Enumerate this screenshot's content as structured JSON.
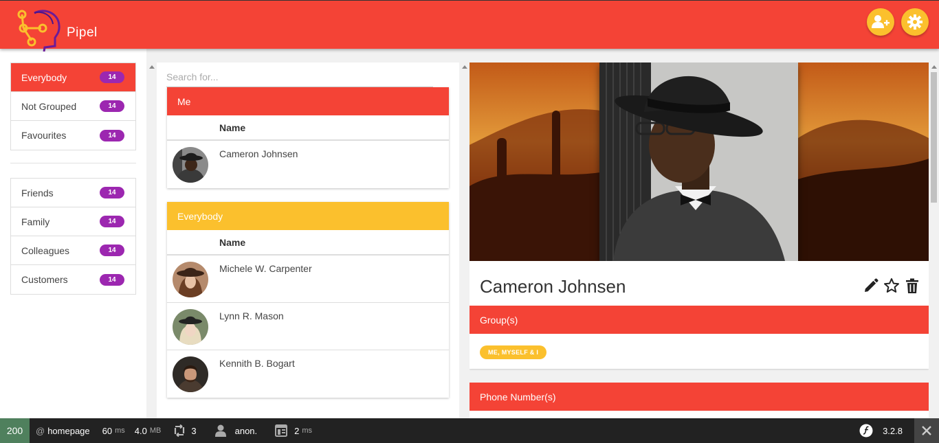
{
  "app": {
    "brand": "Pipel"
  },
  "header": {
    "add_contact_icon": "add-user-icon",
    "settings_icon": "gear-icon"
  },
  "sidebar": {
    "groups_top": [
      {
        "label": "Everybody",
        "count": "14",
        "active": true
      },
      {
        "label": "Not Grouped",
        "count": "14",
        "active": false
      },
      {
        "label": "Favourites",
        "count": "14",
        "active": false
      }
    ],
    "groups_custom": [
      {
        "label": "Friends",
        "count": "14"
      },
      {
        "label": "Family",
        "count": "14"
      },
      {
        "label": "Colleagues",
        "count": "14"
      },
      {
        "label": "Customers",
        "count": "14"
      }
    ]
  },
  "list": {
    "search_placeholder": "Search for...",
    "sections": [
      {
        "title": "Me",
        "column": "Name",
        "color": "#f44336",
        "rows": [
          {
            "name": "Cameron Johnsen"
          }
        ]
      },
      {
        "title": "Everybody",
        "column": "Name",
        "color": "#fbc02d",
        "rows": [
          {
            "name": "Michele W. Carpenter"
          },
          {
            "name": "Lynn R. Mason"
          },
          {
            "name": "Kennith B. Bogart"
          }
        ]
      }
    ]
  },
  "detail": {
    "name": "Cameron Johnsen",
    "groups_title": "Group(s)",
    "group_chip": "ME, MYSELF & I",
    "phones_title": "Phone Number(s)"
  },
  "toolbar": {
    "status": "200",
    "route_prefix": "@",
    "route": "homepage",
    "time": "60",
    "time_unit": "ms",
    "memory": "4.0",
    "memory_unit": "MB",
    "requests": "3",
    "user": "anon.",
    "twig_time": "2",
    "twig_unit": "ms",
    "version": "3.2.8"
  },
  "colors": {
    "primary": "#f44336",
    "accent": "#fbc02d",
    "badge": "#9c27b0",
    "status_ok": "#4f805d"
  }
}
